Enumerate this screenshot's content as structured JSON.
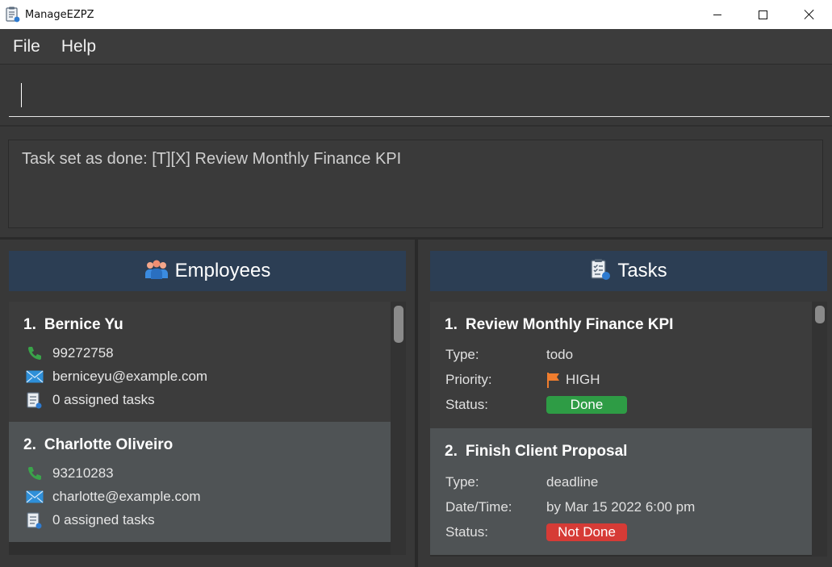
{
  "window": {
    "title": "ManageEZPZ"
  },
  "menu": {
    "items": [
      "File",
      "Help"
    ]
  },
  "command": {
    "value": ""
  },
  "result": {
    "message": "Task set as done: [T][X] Review Monthly Finance KPI"
  },
  "employees_panel": {
    "title": "Employees",
    "items": [
      {
        "index": "1.",
        "name": "Bernice Yu",
        "phone": "99272758",
        "email": "berniceyu@example.com",
        "tasks": "0 assigned tasks"
      },
      {
        "index": "2.",
        "name": "Charlotte Oliveiro",
        "phone": "93210283",
        "email": "charlotte@example.com",
        "tasks": "0 assigned tasks"
      }
    ]
  },
  "tasks_panel": {
    "title": "Tasks",
    "labels": {
      "type": "Type:",
      "priority": "Priority:",
      "status": "Status:",
      "datetime": "Date/Time:"
    },
    "items": [
      {
        "index": "1.",
        "name": "Review Monthly Finance KPI",
        "type": "todo",
        "priority": "HIGH",
        "status": "Done"
      },
      {
        "index": "2.",
        "name": "Finish Client Proposal",
        "type": "deadline",
        "datetime": "by Mar 15 2022 6:00 pm",
        "status": "Not Done"
      }
    ]
  },
  "colors": {
    "header_bg": "#2c3e54",
    "done": "#2e9c45",
    "not_done": "#d63b36",
    "priority_high": "#f07d2e",
    "phone_icon": "#3aa34a",
    "email_icon": "#2e8fd8"
  }
}
